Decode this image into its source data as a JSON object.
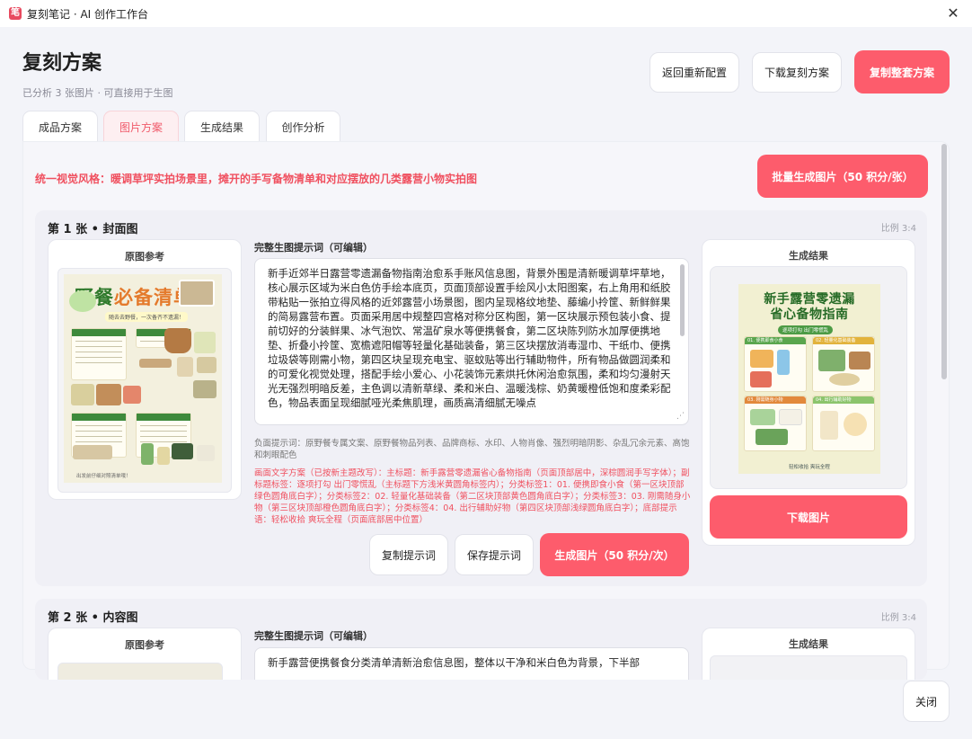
{
  "window": {
    "title": "复刻笔记 · AI 创作工作台",
    "logo_glyph": "笔"
  },
  "header": {
    "title": "复刻方案",
    "subtitle": "已分析 3 张图片 · 可直接用于生图",
    "buttons": {
      "back": "返回重新配置",
      "download": "下载复刻方案",
      "copy_all": "复制整套方案"
    }
  },
  "tabs": [
    {
      "label": "成品方案",
      "active": false
    },
    {
      "label": "图片方案",
      "active": true
    },
    {
      "label": "生成结果",
      "active": false
    },
    {
      "label": "创作分析",
      "active": false
    }
  ],
  "style_line": "统一视觉风格：暖调草坪实拍场景里，摊开的手写备物清单和对应摆放的几类露营小物实拍图",
  "batch_button": "批量生成图片（50 积分/张）",
  "cards": [
    {
      "title": "第 1 张 • 封面图",
      "ratio": "比例 3:4",
      "ref_label": "原图参考",
      "prompt_label": "完整生图提示词（可编辑）",
      "prompt": "新手近郊半日露营零遗漏备物指南治愈系手账风信息图，背景外围是清新暖调草坪草地，核心展示区域为米白色仿手绘本底页，页面顶部设置手绘风小太阳图案，右上角用和纸胶带粘贴一张拍立得风格的近郊露营小场景图，图内呈现格纹地垫、藤编小拎筐、新鲜鲜果的简易露营布置。页面采用居中规整四宫格对称分区构图，第一区块展示预包装小食、提前切好的分装鲜果、冰气泡饮、常温矿泉水等便携餐食，第二区块陈列防水加厚便携地垫、折叠小拎筐、宽檐遮阳帽等轻量化基础装备，第三区块摆放消毒湿巾、干纸巾、便携垃圾袋等刚需小物，第四区块呈现充电宝、驱蚊贴等出行辅助物件，所有物品做圆润柔和的可爱化视觉处理，搭配手绘小爱心、小花装饰元素烘托休闲治愈氛围，柔和均匀漫射天光无强烈明暗反差，主色调以清新草绿、柔和米白、温暖浅棕、奶黄暖橙低饱和度柔彩配色，物品表面呈现细腻哑光柔焦肌理，画质高清细腻无噪点",
      "negative": "负面提示词：原野餐专属文案、原野餐物品列表、品牌商标、水印、人物肖像、强烈明暗阴影、杂乱冗余元素、高饱和刺眼配色",
      "text_plan": "画面文字方案（已按新主题改写）：主标题：新手露营零遗漏省心备物指南（页面顶部居中，深棕圆润手写字体）；副标题标签：逐项打勾 出门零慌乱（主标题下方浅米黄圆角标签内）；分类标签1：01. 便携即食小食（第一区块顶部绿色圆角底白字）；分类标签2：02. 轻量化基础装备（第二区块顶部黄色圆角底白字）；分类标签3：03. 刚需随身小物（第三区块顶部橙色圆角底白字）；分类标签4：04. 出行辅助好物（第四区块顶部浅绿圆角底白字）；底部提示语：轻松收拾 爽玩全程（页面底部居中位置）",
      "buttons": {
        "copy": "复制提示词",
        "save": "保存提示词",
        "generate": "生成图片（50 积分/次）",
        "download": "下载图片"
      },
      "result_label": "生成结果",
      "orig_poster": {
        "title_a": "野餐",
        "title_b": "必备清单",
        "sub": "随去去野餐，一次备齐不遗漏！",
        "foot": "出发前仔细对照清单哦！"
      },
      "gen_poster": {
        "title_l1": "新手露营零遗漏",
        "title_l2": "省心备物指南",
        "tag": "逐项打勾  出门零慌乱",
        "cells": [
          "01. 便携即食小食",
          "02. 轻量化基础装备",
          "03. 刚需随身小物",
          "04. 出行辅助好物"
        ],
        "foot": "轻松收拾  爽玩全程"
      }
    },
    {
      "title": "第 2 张 • 内容图",
      "ratio": "比例 3:4",
      "ref_label": "原图参考",
      "prompt_label": "完整生图提示词（可编辑）",
      "prompt": "新手露营便携餐食分类清单清新治愈信息图，整体以干净和米白色为背景，下半部",
      "result_label": "生成结果"
    }
  ],
  "footer": {
    "close": "关闭"
  },
  "colors": {
    "accent": "#fd5c6c",
    "tab_active_bg": "#fdeff1",
    "warning_text": "#f0505f",
    "poster_green": "#2f7a2c"
  }
}
